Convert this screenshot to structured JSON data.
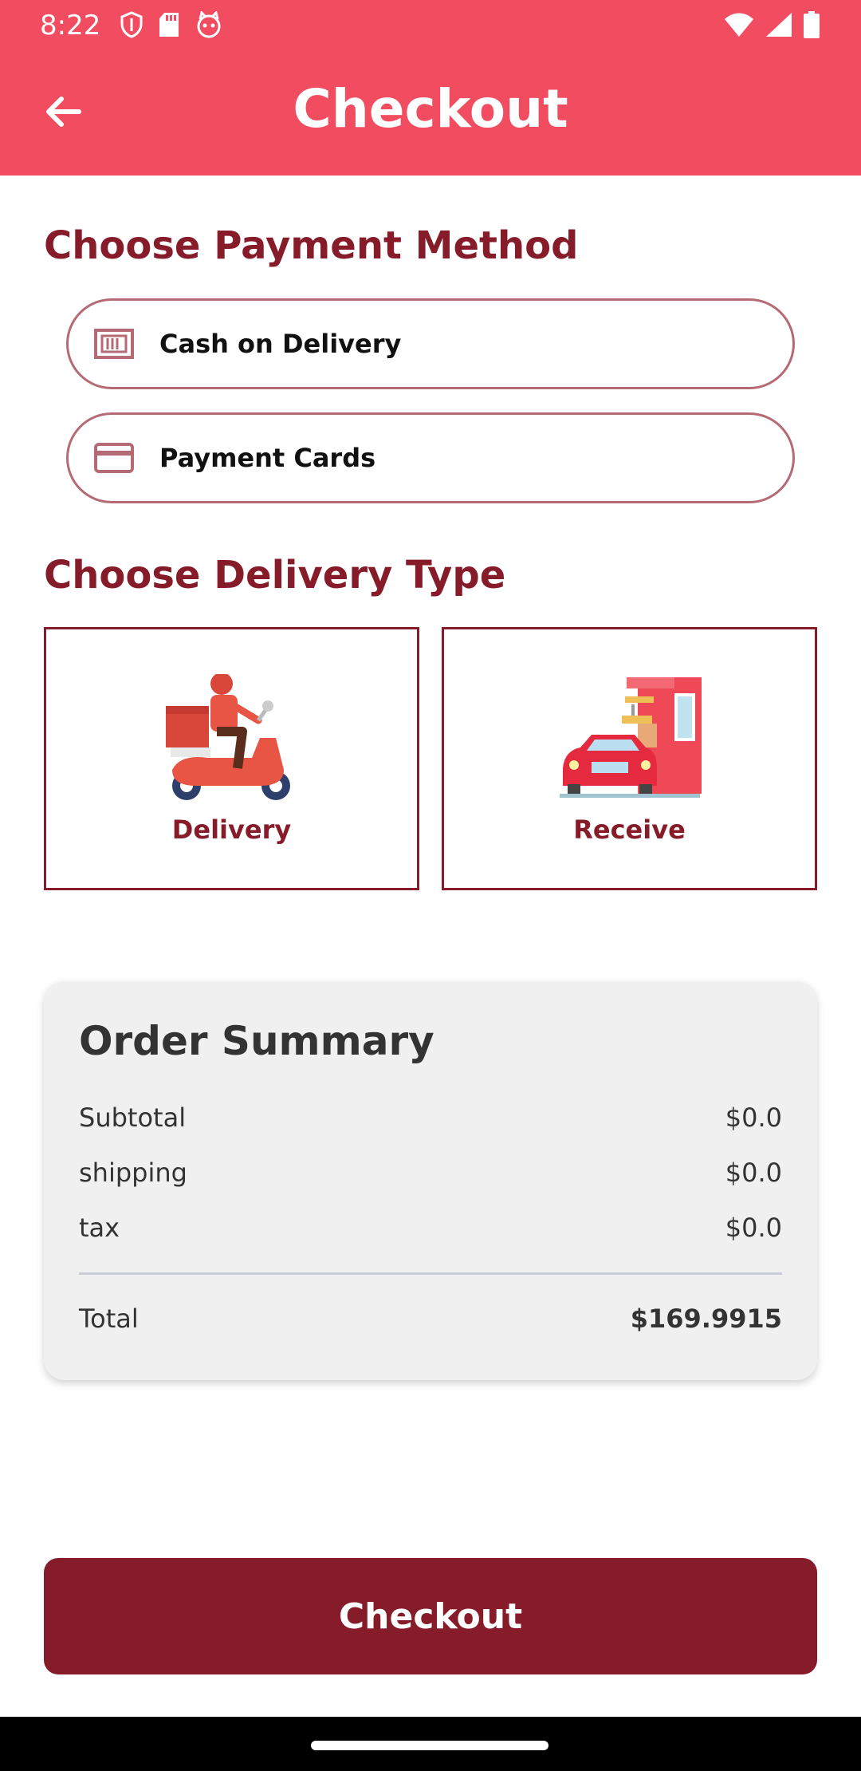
{
  "status_bar": {
    "time": "8:22",
    "left_icons": [
      "shield-icon",
      "sd-card-icon",
      "cat-face-icon"
    ],
    "right_icons": [
      "wifi-icon",
      "signal-icon",
      "battery-icon"
    ]
  },
  "app_bar": {
    "title": "Checkout",
    "back_icon": "arrow-left-icon"
  },
  "payment": {
    "title": "Choose Payment Method",
    "options": [
      {
        "label": "Cash on Delivery",
        "icon": "cash-icon"
      },
      {
        "label": "Payment Cards",
        "icon": "credit-card-icon"
      }
    ]
  },
  "delivery": {
    "title": "Choose Delivery Type",
    "options": [
      {
        "label": "Delivery",
        "icon": "scooter-courier-icon"
      },
      {
        "label": "Receive",
        "icon": "drive-thru-icon"
      }
    ]
  },
  "summary": {
    "title": "Order Summary",
    "rows": [
      {
        "label": "Subtotal",
        "value": "$0.0"
      },
      {
        "label": "shipping",
        "value": "$0.0"
      },
      {
        "label": "tax",
        "value": "$0.0"
      }
    ],
    "total_label": "Total",
    "total_value": "$169.9915"
  },
  "checkout_button": {
    "label": "Checkout"
  },
  "colors": {
    "header": "#f24c60",
    "accent": "#861c2a",
    "summary_bg": "#f0f0f0"
  }
}
